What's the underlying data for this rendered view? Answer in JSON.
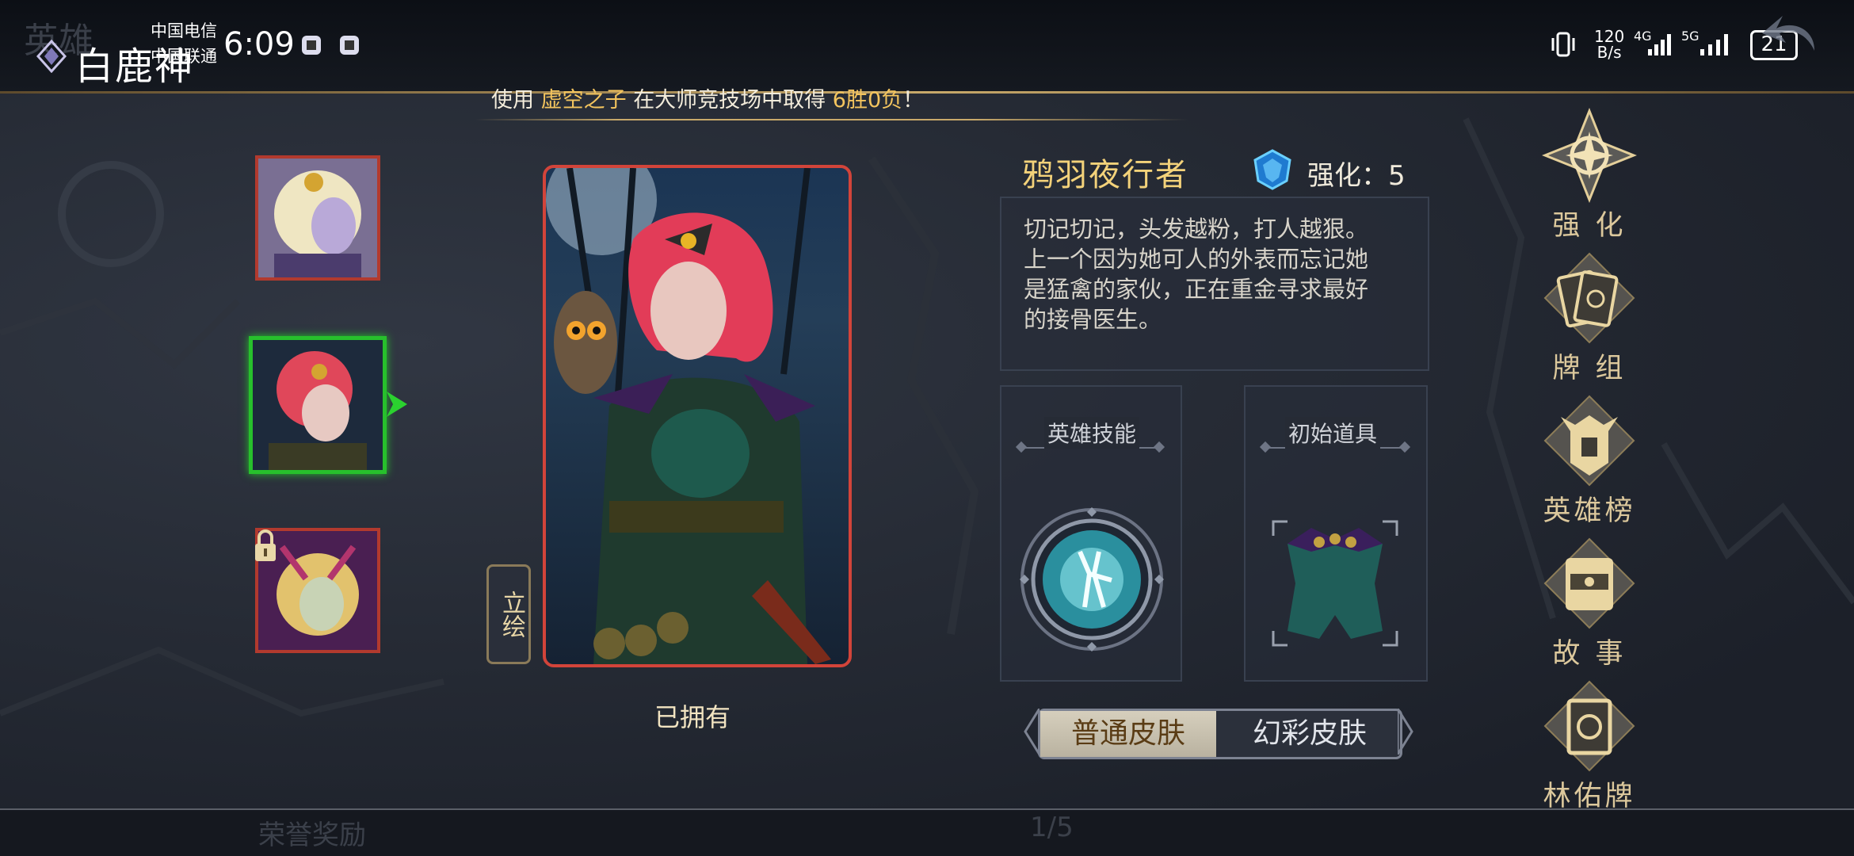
{
  "status": {
    "app_title": "白鹿神",
    "carrier_1": "中国电信",
    "carrier_2": "中国联通",
    "time": "6:09",
    "net_speed_value": "120",
    "net_speed_unit": "B/s",
    "net_4g": "4G",
    "net_5g": "5G",
    "battery": "21",
    "ghost_title": "英雄"
  },
  "marquee": {
    "prefix": "使用",
    "hero": "虚空之子",
    "middle": "在大师竞技场中取得",
    "record": "6胜0负",
    "suffix": "！"
  },
  "hero_list": [
    {
      "name": "hero-1",
      "selected": false,
      "locked": false
    },
    {
      "name": "hero-2",
      "selected": true,
      "locked": false
    },
    {
      "name": "hero-3",
      "selected": false,
      "locked": true
    }
  ],
  "portrait": {
    "lihui_label": "立绘",
    "owned_label": "已拥有"
  },
  "hero_info": {
    "name": "鸦羽夜行者",
    "enhance_label": "强化：5",
    "description_lines": [
      "切记切记，头发越粉，打人越狠。",
      "上一个因为她可人的外表而忘记她",
      "是猛禽的家伙，正在重金寻求最好",
      "的接骨医生。"
    ],
    "skill_title": "英雄技能",
    "item_title": "初始道具"
  },
  "skin_toggle": {
    "normal": "普通皮肤",
    "holo": "幻彩皮肤",
    "active": "normal"
  },
  "right_menu": [
    {
      "label": "强 化",
      "icon": "enhance-compass-icon"
    },
    {
      "label": "牌 组",
      "icon": "cards-deck-icon"
    },
    {
      "label": "英雄榜",
      "icon": "helmet-ranking-icon"
    },
    {
      "label": "故 事",
      "icon": "story-book-icon"
    },
    {
      "label": "林佑牌",
      "icon": "card-frame-icon"
    }
  ],
  "bottom": {
    "honor": "荣誉奖励",
    "page": "1/5"
  },
  "colors": {
    "gold": "#f3d27a",
    "highlight": "#f3c45e",
    "selected_border": "#27c02c",
    "card_border": "#d2443a",
    "background": "#1d222c"
  }
}
